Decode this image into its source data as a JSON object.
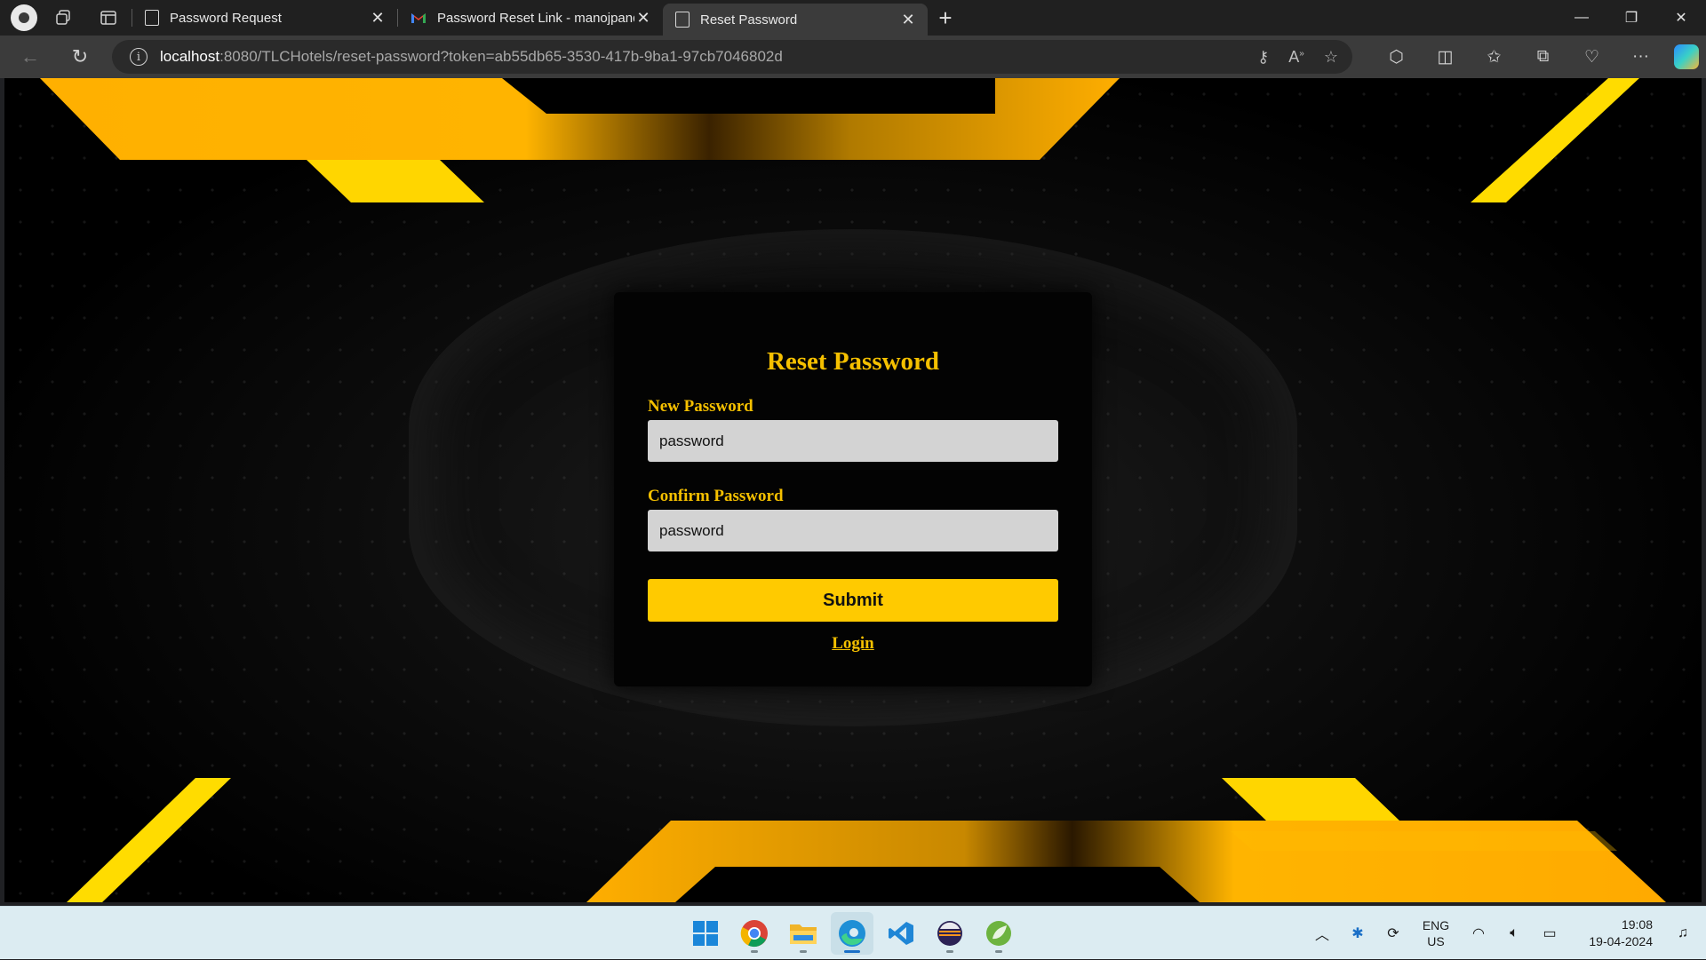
{
  "browser": {
    "tabs": [
      {
        "title": "Password Request",
        "icon": "page-icon",
        "active": false
      },
      {
        "title": "Password Reset Link - manojpand",
        "icon": "gmail-icon",
        "active": false
      },
      {
        "title": "Reset Password",
        "icon": "page-icon",
        "active": true
      }
    ],
    "url_host": "localhost",
    "url_rest": ":8080/TLCHotels/reset-password?token=ab55db65-3530-417b-9ba1-97cb7046802d"
  },
  "form": {
    "title": "Reset Password",
    "new_password_label": "New Password",
    "new_password_value": "password",
    "confirm_password_label": "Confirm Password",
    "confirm_password_value": "password",
    "submit_label": "Submit",
    "login_link": "Login"
  },
  "theme": {
    "accent": "#f5c000",
    "button": "#ffca00",
    "card": "#030303",
    "input": "#d3d3d3"
  },
  "taskbar": {
    "apps": [
      "windows-start-icon",
      "chrome-icon",
      "file-explorer-icon",
      "edge-icon",
      "vscode-icon",
      "eclipse-icon",
      "spring-tool-icon"
    ],
    "lang_line1": "ENG",
    "lang_line2": "US",
    "time": "19:08",
    "date": "19-04-2024"
  }
}
